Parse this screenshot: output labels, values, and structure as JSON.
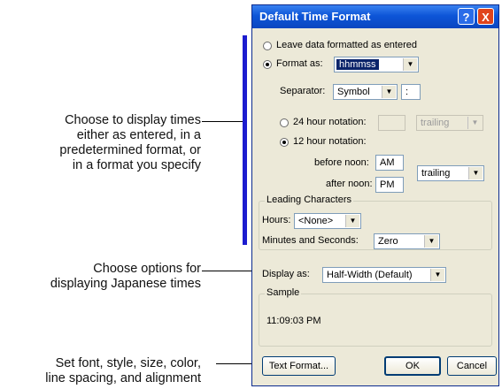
{
  "callouts": {
    "time_display": [
      "Choose to display times",
      "either as entered, in a",
      "predetermined format, or",
      "in a format you specify"
    ],
    "japanese": [
      "Choose options for",
      "displaying Japanese times"
    ],
    "text_format": [
      "Set font, style, size, color,",
      "line spacing, and alignment"
    ]
  },
  "dialog": {
    "title": "Default Time Format",
    "help_button": "?",
    "close_button": "X",
    "leave_label": "Leave data formatted as entered",
    "format_as_label": "Format as:",
    "format_as_value": "hhmmss",
    "separator_label": "Separator:",
    "separator_value": "Symbol",
    "separator_symbol": ":",
    "notation24_label": "24 hour notation:",
    "notation24_position": "trailing",
    "notation12_label": "12 hour notation:",
    "before_noon_label": "before noon:",
    "before_noon_value": "AM",
    "after_noon_label": "after noon:",
    "after_noon_value": "PM",
    "notation12_position": "trailing",
    "leading_group": "Leading Characters",
    "hours_label": "Hours:",
    "hours_value": "<None>",
    "minsec_label": "Minutes and Seconds:",
    "minsec_value": "Zero",
    "display_as_label": "Display as:",
    "display_as_value": "Half-Width (Default)",
    "sample_group": "Sample",
    "sample_value": "11:09:03 PM",
    "text_format_button": "Text Format...",
    "ok_button": "OK",
    "cancel_button": "Cancel"
  },
  "colors": {
    "accent_bar": "#1c1ccf",
    "title_bar": "#0d55d8",
    "dialog_bg": "#ece9d8"
  }
}
